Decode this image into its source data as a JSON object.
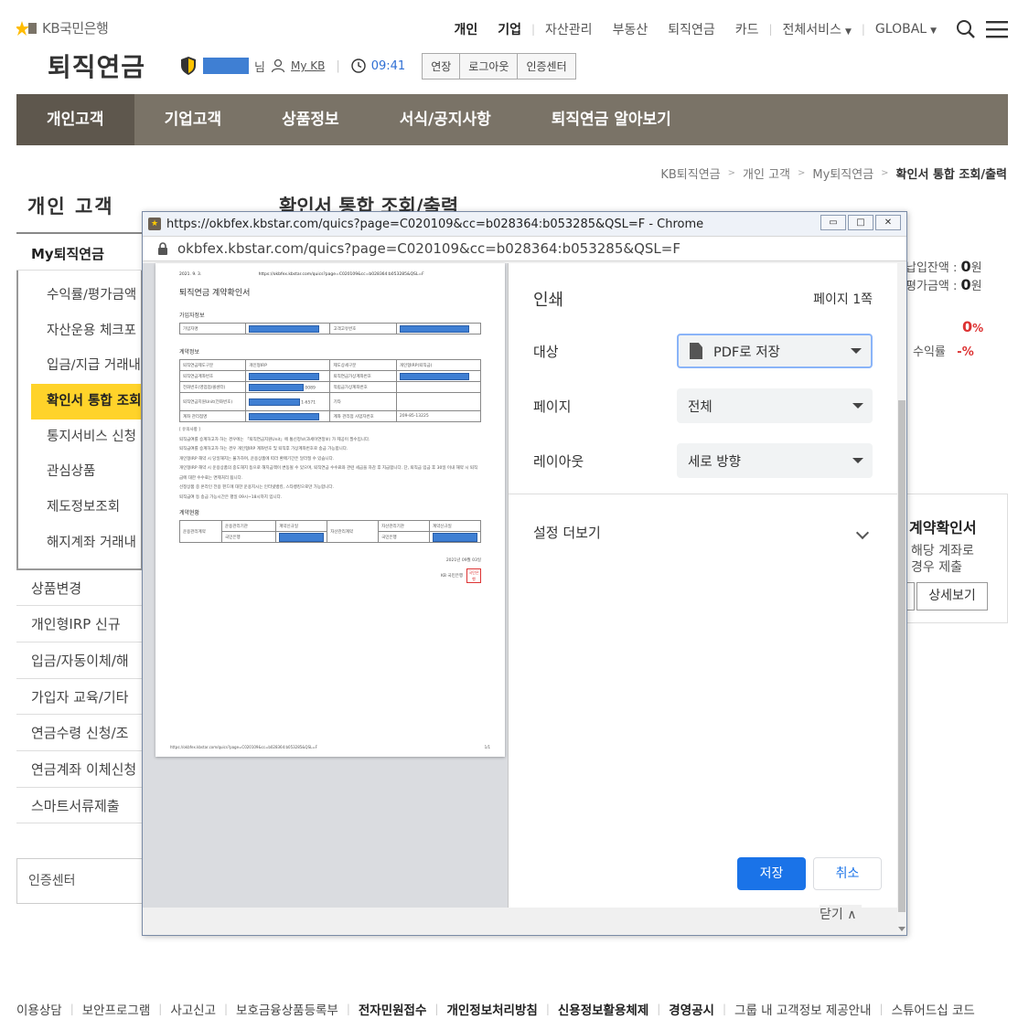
{
  "header": {
    "logo_text": "KB국민은행",
    "nav": [
      "개인",
      "기업",
      "자산관리",
      "부동산",
      "퇴직연금",
      "카드",
      "전체서비스",
      "GLOBAL"
    ],
    "title": "퇴직연금",
    "user_suffix": "님",
    "mykb": "My KB",
    "time": "09:41",
    "buttons": [
      "연장",
      "로그아웃",
      "인증센터"
    ]
  },
  "gnb": [
    "개인고객",
    "기업고객",
    "상품정보",
    "서식/공지사항",
    "퇴직연금 알아보기"
  ],
  "breadcrumb": [
    "KB퇴직연금",
    "개인 고객",
    "My퇴직연금",
    "확인서 통합 조회/출력"
  ],
  "lnb": {
    "title": "개인 고객",
    "group": "My퇴직연금",
    "sub": [
      "수익률/평가금액",
      "자산운용 체크포",
      "입금/지급 거래내",
      "확인서 통합 조회",
      "통지서비스 신청",
      "관심상품",
      "제도정보조회",
      "해지계좌 거래내"
    ],
    "main": [
      "상품변경",
      "개인형IRP 신규",
      "입금/자동이체/해",
      "가입자 교육/기타",
      "연금수령 신청/조",
      "연금계좌 이체신청",
      "스마트서류제출"
    ],
    "cert": "인증센터"
  },
  "content_title": "확인서 통합 조회/출력",
  "right_peek": {
    "balance1": "납입잔액 : ",
    "balance1_val": "0",
    "won1": "원",
    "balance2": "평가금액 : ",
    "balance2_val": "0",
    "won2": "원",
    "rate_val": "0",
    "pct": "%",
    "yield_label": "수익률",
    "yield_val": "-%",
    "card_title": "계약확인서",
    "card_line1": "해당 계좌로",
    "card_line2": "경우 제출",
    "detail_btn": "상세보기",
    "behind_close": "닫기 ∧"
  },
  "popup": {
    "title": "https://okbfex.kbstar.com/quics?page=C020109&cc=b028364:b053285&QSL=F - Chrome",
    "url": "okbfex.kbstar.com/quics?page=C020109&cc=b028364:b053285&QSL=F",
    "print": {
      "heading": "인쇄",
      "pages_count": "페이지 1쪽",
      "dest_label": "대상",
      "dest_value": "PDF로 저장",
      "pages_label": "페이지",
      "pages_value": "전체",
      "layout_label": "레이아웃",
      "layout_value": "세로 방향",
      "more": "설정 더보기",
      "save": "저장",
      "cancel": "취소"
    },
    "doc": {
      "date_hdr": "2021. 9. 3.",
      "url_hdr": "https://okbfex.kbstar.com/quics?page=C020109&cc=b028364:b053285&QSL=F",
      "title": "퇴직연금 계약확인서",
      "sec1": "가입자정보",
      "t1": [
        "가입자명",
        "고객고유번호"
      ],
      "sec2": "계약정보",
      "t2": [
        [
          "퇴직연금제도구분",
          "개인형IRP",
          "제도상세구분",
          "개인형IRP(퇴직금)"
        ],
        [
          "퇴직연금계좌번호",
          "",
          "퇴직연금가상계좌번호",
          ""
        ],
        [
          "전화번호(영업점/콜센터)",
          "0089",
          "적립금가상계좌번호",
          ""
        ],
        [
          "퇴직연금지원Unit(전화번호)",
          "1-6571",
          "기타",
          ""
        ],
        [
          "계좌 관리점명",
          "",
          "계좌 관리점 사업자번호",
          "209-85-13225"
        ]
      ],
      "note_title": "[ 유의사항 ]",
      "notes": [
        "퇴직급여를 승계하고자 하는 경우에는 「퇴직연금지원Unit」에 통신정보(과세이연정보) 가 제공이 필수입니다.",
        "퇴직급여를 승계하고자 하는 경우 개인형IRP 계좌번호 및 퇴직후 가상계좌번호로 송금 가능합니다.",
        "개인형IRP 해약 시 당일해지는 불가하며, 운용상품에 따라 환매기간은 달라질 수 있습니다.",
        "개인형IRP 해약 시 운용상품의 중도해지 등으로 해지금액이 변동될 수 있으며, 퇴직연금 수수료와 관련 세금을 차감 후 지급합니다. 단, 퇴직금 입금 후 30일 이내 해약 시 퇴직금에 대한 수수료는 면제처리 됩니다.",
        "선정상품 중 온라인 전용 펀드에 대한 운용지시는 인터넷뱅킹, 스타뱅킹으로만 가능합니다.",
        "퇴직급여 등 송금 가능시간은 평일 09시~18시까지 입니다."
      ],
      "sec3": "계약현황",
      "t3a": [
        "운용관리계약",
        "운용관리기관",
        "계약신규일",
        "국민은행"
      ],
      "t3b": [
        "자산관리계약",
        "자산관리기관",
        "계약신규일",
        "국민은행"
      ],
      "issue_date": "2021년 09월 03일",
      "issuer": "KB 국민은행",
      "seal": "국민은행",
      "foot_url": "https://okbfex.kbstar.com/quics?page=C020109&cc=b028364:b053285&QSL=F",
      "foot_page": "1/1"
    }
  },
  "footer": [
    {
      "t": "이용상담",
      "b": false
    },
    {
      "t": "보안프로그램",
      "b": false
    },
    {
      "t": "사고신고",
      "b": false
    },
    {
      "t": "보호금융상품등록부",
      "b": false
    },
    {
      "t": "전자민원접수",
      "b": true
    },
    {
      "t": "개인정보처리방침",
      "b": true
    },
    {
      "t": "신용정보활용체제",
      "b": true
    },
    {
      "t": "경영공시",
      "b": true
    },
    {
      "t": "그룹 내 고객정보 제공안내",
      "b": false
    },
    {
      "t": "스튜어드십 코드",
      "b": false
    }
  ]
}
